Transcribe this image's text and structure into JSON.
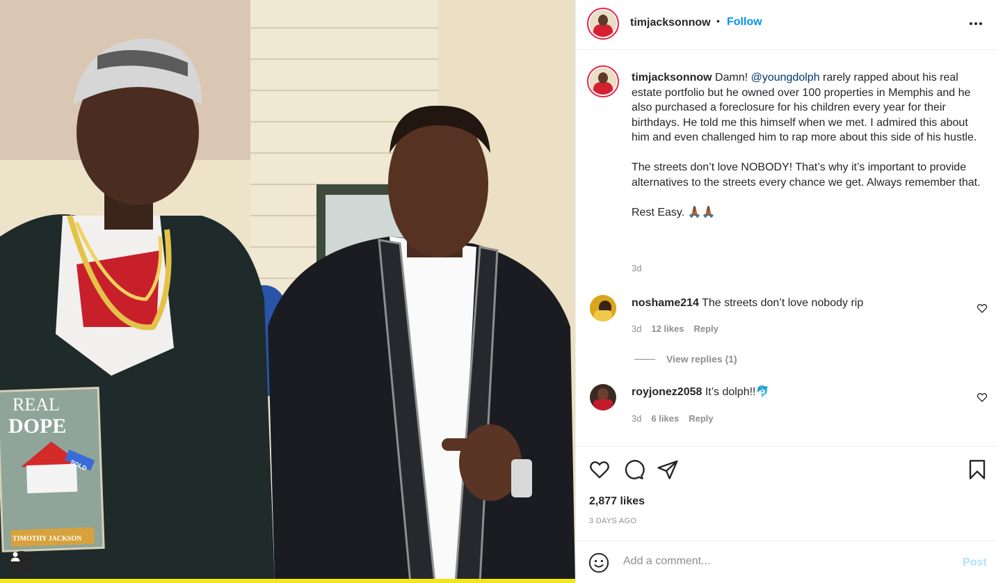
{
  "post": {
    "username": "timjacksonnow",
    "follow_label": "Follow",
    "more_icon": "more-options-icon",
    "photo": {
      "book_title_line1": "REAL",
      "book_title_line2": "DOPE",
      "book_author": "TIMOTHY JACKSON",
      "sign_text": "SOLD"
    },
    "caption": {
      "username": "timjacksonnow",
      "text_before_mention": "Damn! ",
      "mention": "@youngdolph",
      "text_after_mention": " rarely rapped about his real estate portfolio but he owned over 100 properties in Memphis and he also purchased a foreclosure for his children every year for their birthdays. He told me this himself when we met. I admired this about him and even challenged him to rap more about this side of his hustle.",
      "paragraph2": "The streets don’t love NOBODY! That’s why it’s important to provide alternatives to the streets every chance we get. Always remember that.",
      "paragraph3": "Rest Easy. 🙏🏾🙏🏾",
      "time": "3d"
    },
    "comments": [
      {
        "username": "noshame214",
        "text": "The streets don’t love nobody rip",
        "time": "3d",
        "likes": "12 likes",
        "reply": "Reply",
        "view_replies": "View replies (1)"
      },
      {
        "username": "royjonez2058",
        "text": "It’s dolph!!🐬",
        "time": "3d",
        "likes": "6 likes",
        "reply": "Reply"
      }
    ],
    "likes": "2,877 likes",
    "posted": "3 DAYS AGO",
    "comment_placeholder": "Add a comment...",
    "post_label": "Post"
  },
  "colors": {
    "accent": "#0095f6",
    "mention": "#00376b",
    "muted": "#8e8e8e",
    "post_disabled": "#b2dffc"
  }
}
